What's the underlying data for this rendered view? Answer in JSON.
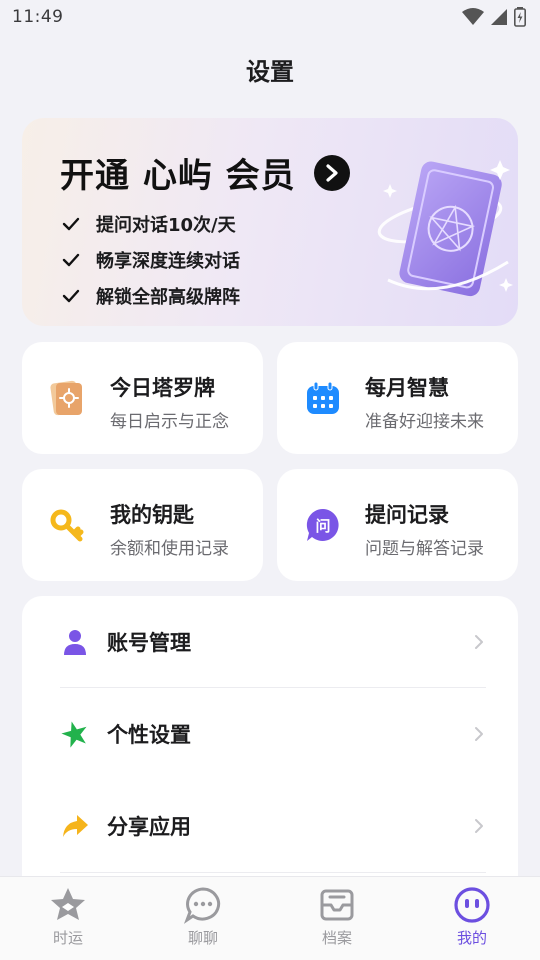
{
  "status_bar": {
    "time": "11:49"
  },
  "page": {
    "title": "设置"
  },
  "vip": {
    "title": "开通 心屿 会员",
    "perks": [
      "提问对话10次/天",
      "畅享深度连续对话",
      "解锁全部高级牌阵"
    ]
  },
  "tiles": [
    {
      "title": "今日塔罗牌",
      "subtitle": "每日启示与正念",
      "icon": "tarot-card-icon"
    },
    {
      "title": "每月智慧",
      "subtitle": "准备好迎接未来",
      "icon": "calendar-icon"
    },
    {
      "title": "我的钥匙",
      "subtitle": "余额和使用记录",
      "icon": "key-icon"
    },
    {
      "title": "提问记录",
      "subtitle": "问题与解答记录",
      "icon": "question-chat-icon"
    }
  ],
  "menu": [
    {
      "label": "账号管理",
      "icon": "user-icon"
    },
    {
      "label": "个性设置",
      "icon": "star-leaf-icon"
    },
    {
      "label": "分享应用",
      "icon": "share-arrow-icon"
    }
  ],
  "tabs": [
    {
      "label": "时运",
      "icon": "star-badge-icon",
      "active": false
    },
    {
      "label": "聊聊",
      "icon": "chat-bubble-icon",
      "active": false
    },
    {
      "label": "档案",
      "icon": "inbox-tray-icon",
      "active": false
    },
    {
      "label": "我的",
      "icon": "profile-face-icon",
      "active": true
    }
  ],
  "colors": {
    "accent": "#6c4fe0",
    "background": "#f2f2f7",
    "card": "#ffffff",
    "tab_inactive": "#9a9a9e"
  }
}
